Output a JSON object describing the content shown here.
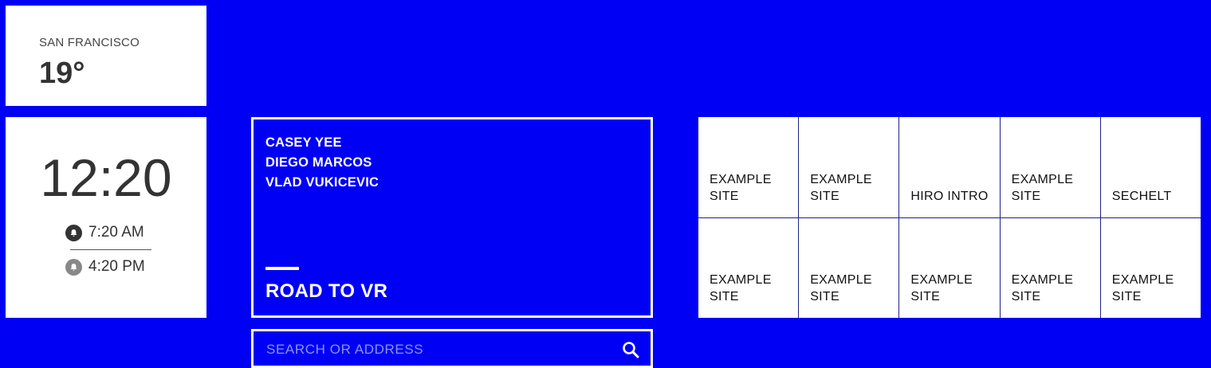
{
  "weather": {
    "city": "SAN FRANCISCO",
    "temperature": "19°"
  },
  "clock": {
    "time": "12:20",
    "alarms": [
      {
        "time": "7:20 AM",
        "icon": "bell-icon"
      },
      {
        "time": "4:20 PM",
        "icon": "bell-icon"
      }
    ]
  },
  "feature": {
    "names": [
      "CASEY YEE",
      "DIEGO MARCOS",
      "VLAD VUKICEVIC"
    ],
    "title": "ROAD TO VR"
  },
  "search": {
    "placeholder": "SEARCH OR ADDRESS",
    "icon": "search-icon"
  },
  "tiles": [
    {
      "label": "EXAMPLE SITE"
    },
    {
      "label": "EXAMPLE SITE"
    },
    {
      "label": "HIRO INTRO"
    },
    {
      "label": "EXAMPLE SITE"
    },
    {
      "label": "SECHELT"
    },
    {
      "label": "EXAMPLE SITE"
    },
    {
      "label": "EXAMPLE SITE"
    },
    {
      "label": "EXAMPLE SITE"
    },
    {
      "label": "EXAMPLE SITE"
    },
    {
      "label": "EXAMPLE SITE"
    }
  ],
  "colors": {
    "background": "#0000f5",
    "card": "#ffffff",
    "text": "#333333"
  }
}
